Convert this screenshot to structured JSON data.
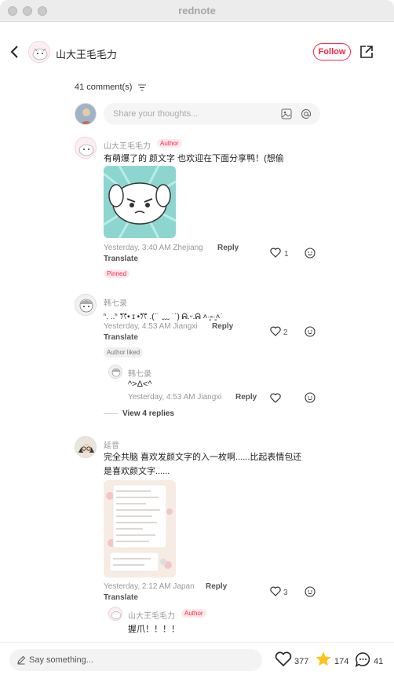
{
  "window": {
    "title": "rednote"
  },
  "header": {
    "author_name": "山大王毛毛力",
    "follow_label": "Follow"
  },
  "comments_header": {
    "count_label": "41 comment(s)",
    "input_placeholder": "Share your thoughts..."
  },
  "comments": [
    {
      "name": "山大王毛毛力",
      "badge": "Author",
      "text": "有萌爆了的 颜文字 也欢迎在下面分享鸭！(想偷",
      "meta": "Yesterday, 3:40 AM Zhejiang",
      "reply": "Reply",
      "translate": "Translate",
      "likes": "1",
      "pinned": "Pinned"
    },
    {
      "name": "韩七录",
      "text": "ᑋ. ..ᑋ   ꔫ• ɪ •ꔫ   .(ˊ˙ ﹏ ˙ˋ)  ᕱ.ᵕ.ᕱ   ˄·͈༝·͈˄ᐝ",
      "meta": "Yesterday, 4:53 AM Jiangxi",
      "reply": "Reply",
      "translate": "Translate",
      "likes": "2",
      "author_liked": "Author liked",
      "sub_reply": {
        "name": "韩七录",
        "text": "^>Δ<^",
        "meta": "Yesterday, 4:53 AM Jiangxi",
        "reply": "Reply"
      },
      "view_replies": "View 4 replies"
    },
    {
      "name": "延音",
      "text_line1": "完全共脑 喜欢发颜文字的入一枚啊......比起表情包还",
      "text_line2": "是喜欢颜文字......",
      "meta": "Yesterday, 2:12 AM Japan",
      "reply": "Reply",
      "translate": "Translate",
      "likes": "3",
      "sub_reply": {
        "name": "山大王毛毛力",
        "badge": "Author",
        "text": "握爪！！！！"
      }
    }
  ],
  "bottom_bar": {
    "placeholder": "Say something...",
    "likes": "377",
    "stars": "174",
    "comments": "41"
  },
  "colors": {
    "accent": "#ff2442",
    "star": "#ffc21a"
  }
}
